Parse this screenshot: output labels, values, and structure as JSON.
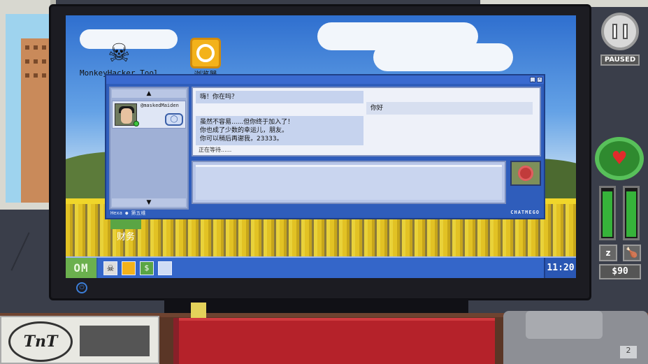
{
  "desktop": {
    "icons": [
      {
        "name": "Monkey Hacker Tool",
        "label": "MonkeyHacker Tool"
      },
      {
        "name": "Browser",
        "label": "浏览器"
      },
      {
        "name": "Finance",
        "label": "财务"
      }
    ]
  },
  "taskbar": {
    "start_label": "OM",
    "clock": "11:20",
    "apps": [
      "monkey-icon",
      "browser-icon",
      "finance-icon",
      "chat-icon"
    ]
  },
  "chat": {
    "brand": "CHATMEGO",
    "footer_user": "Hexa ● 第五维",
    "contact": {
      "name": "@maskedMaiden",
      "online": true
    },
    "messages": [
      {
        "from": "them",
        "text": "嗨！你在吗？"
      },
      {
        "from": "me",
        "text": "你好"
      },
      {
        "from": "them",
        "lines": [
          "虽然不容易......但你终于加入了！",
          "你也成了少数的幸运儿，朋友。",
          "你可以稍后再谢我，23333。"
        ]
      }
    ],
    "status": "正在等待......",
    "compose_value": ""
  },
  "hud": {
    "paused_label": "PAUSED",
    "money": "$90",
    "sleep_icon": "zzz",
    "food_icon": "drumstick",
    "health_icon": "heart",
    "sleep_level": 0.95,
    "hunger_level": 0.95
  },
  "desk": {
    "card_logo": "TnT",
    "phone_key": "2"
  },
  "colors": {
    "taskbar": "#3466c9",
    "start": "#6bb04e",
    "chat_frame": "#2f5dbb",
    "health_ring": "#58c05a",
    "heart": "#e12b2b"
  }
}
